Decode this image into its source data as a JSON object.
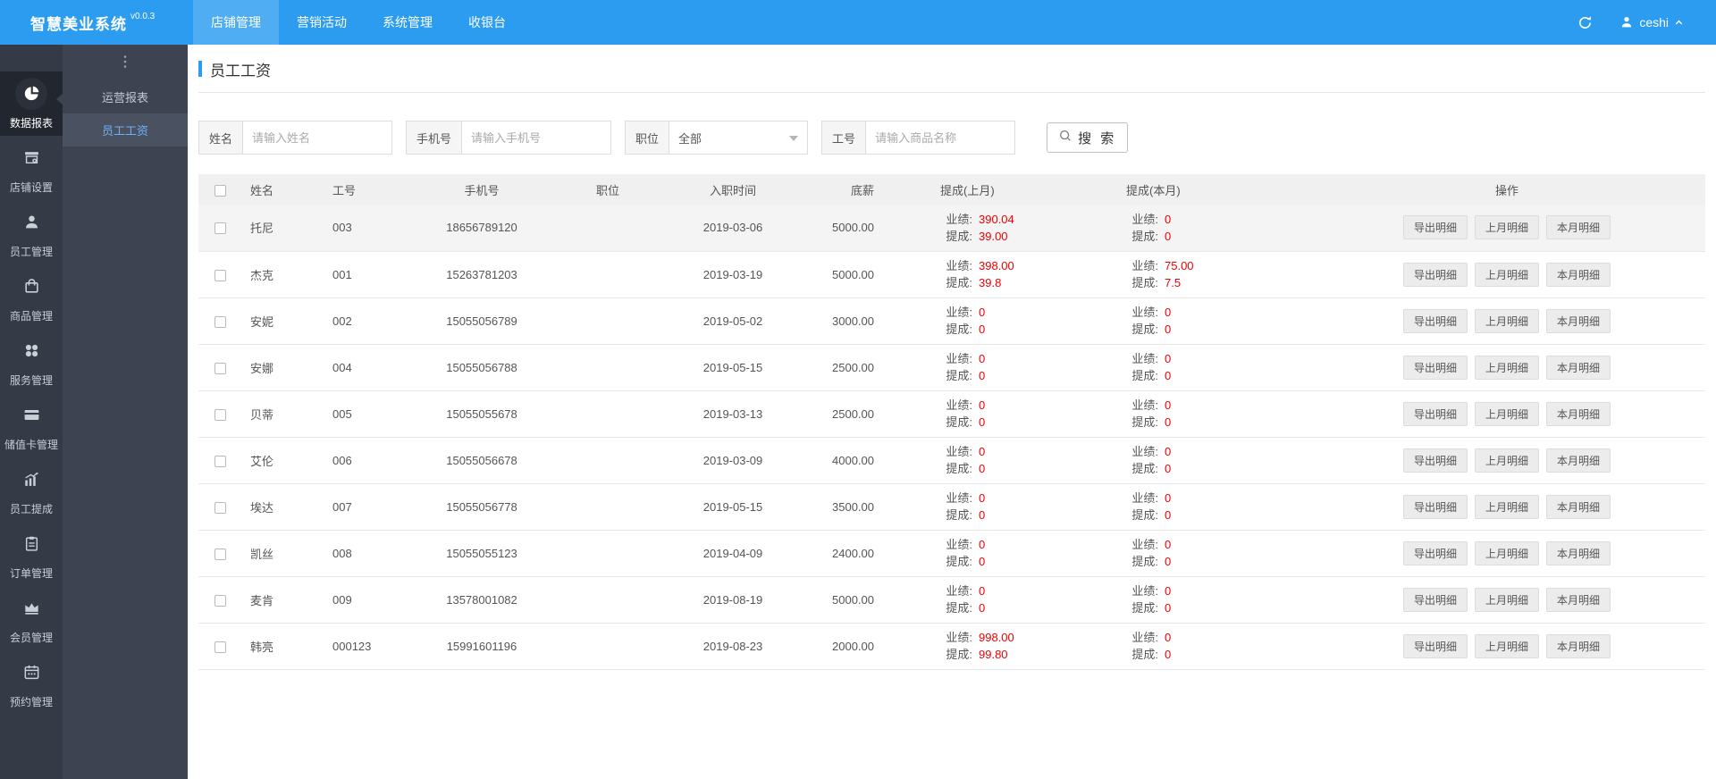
{
  "colors": {
    "brand_blue": "#2b9cf0",
    "active_tab_blue": "#4fadf4",
    "value_red": "#f20000",
    "rail_bg": "#343a46",
    "submenu_bg": "#3d4350"
  },
  "header": {
    "logo": "智慧美业系统",
    "version": "v0.0.3",
    "nav": [
      {
        "id": "store-management",
        "label": "店铺管理",
        "active": true
      },
      {
        "id": "marketing-activity",
        "label": "营销活动",
        "active": false
      },
      {
        "id": "system-management",
        "label": "系统管理",
        "active": false
      },
      {
        "id": "cashier",
        "label": "收银台",
        "active": false
      }
    ],
    "icons": [
      "refresh-icon",
      "user-icon",
      "chevron-up-icon"
    ],
    "user": "ceshi"
  },
  "sidebar": {
    "items": [
      {
        "id": "data-reports",
        "label": "数据报表",
        "icon": "pie-chart",
        "active": true
      },
      {
        "id": "store-settings",
        "label": "店铺设置",
        "icon": "storefront",
        "active": false
      },
      {
        "id": "staff-management",
        "label": "员工管理",
        "icon": "person",
        "active": false
      },
      {
        "id": "goods-management",
        "label": "商品管理",
        "icon": "shopping-bag",
        "active": false
      },
      {
        "id": "service-management",
        "label": "服务管理",
        "icon": "clover",
        "active": false
      },
      {
        "id": "stored-card-management",
        "label": "储值卡管理",
        "icon": "credit-card",
        "active": false
      },
      {
        "id": "staff-commission",
        "label": "员工提成",
        "icon": "chart-growth",
        "active": false
      },
      {
        "id": "order-management",
        "label": "订单管理",
        "icon": "clipboard",
        "active": false
      },
      {
        "id": "member-management",
        "label": "会员管理",
        "icon": "crown",
        "active": false
      },
      {
        "id": "booking-management",
        "label": "预约管理",
        "icon": "calendar",
        "active": false
      }
    ]
  },
  "submenu": {
    "toggle_icon": "dots-vertical",
    "items": [
      {
        "id": "operation-report",
        "label": "运营报表",
        "active": false
      },
      {
        "id": "staff-salary",
        "label": "员工工资",
        "active": true
      }
    ]
  },
  "page": {
    "title": "员工工资"
  },
  "filters": {
    "fields": [
      {
        "id": "name",
        "type": "input",
        "label": "姓名",
        "placeholder": "请输入姓名"
      },
      {
        "id": "phone",
        "type": "input",
        "label": "手机号",
        "placeholder": "请输入手机号"
      },
      {
        "id": "position",
        "type": "select",
        "label": "职位",
        "value": "全部"
      },
      {
        "id": "job-no",
        "type": "input",
        "label": "工号",
        "placeholder": "请输入商品名称"
      }
    ],
    "search_label": "搜 索"
  },
  "table": {
    "columns": [
      "姓名",
      "工号",
      "手机号",
      "职位",
      "入职时间",
      "底薪",
      "提成(上月)",
      "提成(本月)",
      "操作"
    ],
    "commission_labels": {
      "performance": "业绩:",
      "commission": "提成:"
    },
    "actions": [
      "导出明细",
      "上月明细",
      "本月明细"
    ],
    "rows": [
      {
        "name": "托尼",
        "job_no": "003",
        "phone": "18656789120",
        "position": "",
        "hire_date": "2019-03-06",
        "base_salary": "5000.00",
        "last_month": {
          "performance": "390.04",
          "commission": "39.00"
        },
        "this_month": {
          "performance": "0",
          "commission": "0"
        }
      },
      {
        "name": "杰克",
        "job_no": "001",
        "phone": "15263781203",
        "position": "",
        "hire_date": "2019-03-19",
        "base_salary": "5000.00",
        "last_month": {
          "performance": "398.00",
          "commission": "39.8"
        },
        "this_month": {
          "performance": "75.00",
          "commission": "7.5"
        }
      },
      {
        "name": "安妮",
        "job_no": "002",
        "phone": "15055056789",
        "position": "",
        "hire_date": "2019-05-02",
        "base_salary": "3000.00",
        "last_month": {
          "performance": "0",
          "commission": "0"
        },
        "this_month": {
          "performance": "0",
          "commission": "0"
        }
      },
      {
        "name": "安娜",
        "job_no": "004",
        "phone": "15055056788",
        "position": "",
        "hire_date": "2019-05-15",
        "base_salary": "2500.00",
        "last_month": {
          "performance": "0",
          "commission": "0"
        },
        "this_month": {
          "performance": "0",
          "commission": "0"
        }
      },
      {
        "name": "贝蒂",
        "job_no": "005",
        "phone": "15055055678",
        "position": "",
        "hire_date": "2019-03-13",
        "base_salary": "2500.00",
        "last_month": {
          "performance": "0",
          "commission": "0"
        },
        "this_month": {
          "performance": "0",
          "commission": "0"
        }
      },
      {
        "name": "艾伦",
        "job_no": "006",
        "phone": "15055056678",
        "position": "",
        "hire_date": "2019-03-09",
        "base_salary": "4000.00",
        "last_month": {
          "performance": "0",
          "commission": "0"
        },
        "this_month": {
          "performance": "0",
          "commission": "0"
        }
      },
      {
        "name": "埃达",
        "job_no": "007",
        "phone": "15055056778",
        "position": "",
        "hire_date": "2019-05-15",
        "base_salary": "3500.00",
        "last_month": {
          "performance": "0",
          "commission": "0"
        },
        "this_month": {
          "performance": "0",
          "commission": "0"
        }
      },
      {
        "name": "凯丝",
        "job_no": "008",
        "phone": "15055055123",
        "position": "",
        "hire_date": "2019-04-09",
        "base_salary": "2400.00",
        "last_month": {
          "performance": "0",
          "commission": "0"
        },
        "this_month": {
          "performance": "0",
          "commission": "0"
        }
      },
      {
        "name": "麦肯",
        "job_no": "009",
        "phone": "13578001082",
        "position": "",
        "hire_date": "2019-08-19",
        "base_salary": "5000.00",
        "last_month": {
          "performance": "0",
          "commission": "0"
        },
        "this_month": {
          "performance": "0",
          "commission": "0"
        }
      },
      {
        "name": "韩亮",
        "job_no": "000123",
        "phone": "15991601196",
        "position": "",
        "hire_date": "2019-08-23",
        "base_salary": "2000.00",
        "last_month": {
          "performance": "998.00",
          "commission": "99.80"
        },
        "this_month": {
          "performance": "0",
          "commission": "0"
        }
      }
    ]
  }
}
